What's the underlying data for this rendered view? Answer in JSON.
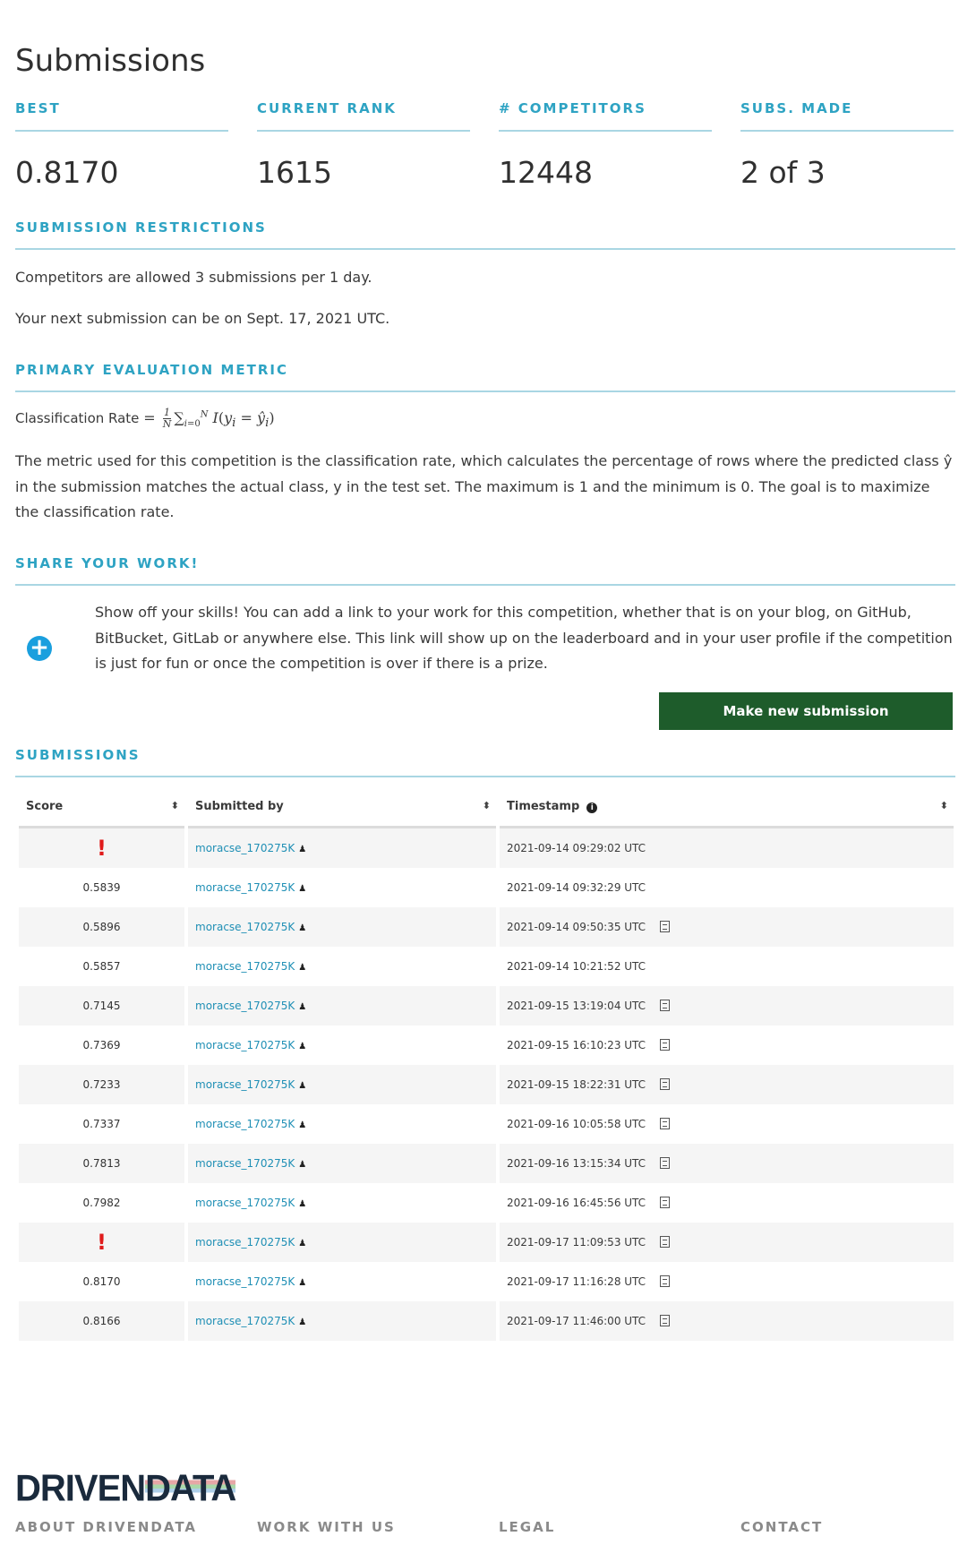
{
  "page": {
    "title": "Submissions"
  },
  "stats": [
    {
      "label": "BEST",
      "value": "0.8170"
    },
    {
      "label": "CURRENT RANK",
      "value": "1615"
    },
    {
      "label": "# COMPETITORS",
      "value": "12448"
    },
    {
      "label": "SUBS. MADE",
      "value": "2 of 3"
    }
  ],
  "restrictions": {
    "heading": "SUBMISSION RESTRICTIONS",
    "line1": "Competitors are allowed 3 submissions per 1 day.",
    "line2": "Your next submission can be on Sept. 17, 2021 UTC."
  },
  "metric": {
    "heading": "PRIMARY EVALUATION METRIC",
    "formula_label": "Classification Rate",
    "description": "The metric used for this competition is the classification rate, which calculates the percentage of rows where the predicted class ŷ in the submission matches the actual class, y in the test set. The maximum is 1 and the minimum is 0. The goal is to maximize the classification rate."
  },
  "share": {
    "heading": "SHARE YOUR WORK!",
    "text": "Show off your skills! You can add a link to your work for this competition, whether that is on your blog, on GitHub, BitBucket, GitLab or anywhere else. This link will show up on the leaderboard and in your user profile if the competition is just for fun or once the competition is over if there is a prize.",
    "icon": "plus-circle-icon"
  },
  "make_submission_label": "Make new submission",
  "submissions": {
    "heading": "SUBMISSIONS",
    "columns": [
      "Score",
      "Submitted by",
      "Timestamp"
    ],
    "rows": [
      {
        "score": "!",
        "error": true,
        "user": "moracse_170275K",
        "timestamp": "2021-09-14 09:29:02 UTC",
        "has_file": false
      },
      {
        "score": "0.5839",
        "error": false,
        "user": "moracse_170275K",
        "timestamp": "2021-09-14 09:32:29 UTC",
        "has_file": false
      },
      {
        "score": "0.5896",
        "error": false,
        "user": "moracse_170275K",
        "timestamp": "2021-09-14 09:50:35 UTC",
        "has_file": true
      },
      {
        "score": "0.5857",
        "error": false,
        "user": "moracse_170275K",
        "timestamp": "2021-09-14 10:21:52 UTC",
        "has_file": false
      },
      {
        "score": "0.7145",
        "error": false,
        "user": "moracse_170275K",
        "timestamp": "2021-09-15 13:19:04 UTC",
        "has_file": true
      },
      {
        "score": "0.7369",
        "error": false,
        "user": "moracse_170275K",
        "timestamp": "2021-09-15 16:10:23 UTC",
        "has_file": true
      },
      {
        "score": "0.7233",
        "error": false,
        "user": "moracse_170275K",
        "timestamp": "2021-09-15 18:22:31 UTC",
        "has_file": true
      },
      {
        "score": "0.7337",
        "error": false,
        "user": "moracse_170275K",
        "timestamp": "2021-09-16 10:05:58 UTC",
        "has_file": true
      },
      {
        "score": "0.7813",
        "error": false,
        "user": "moracse_170275K",
        "timestamp": "2021-09-16 13:15:34 UTC",
        "has_file": true
      },
      {
        "score": "0.7982",
        "error": false,
        "user": "moracse_170275K",
        "timestamp": "2021-09-16 16:45:56 UTC",
        "has_file": true
      },
      {
        "score": "!",
        "error": true,
        "user": "moracse_170275K",
        "timestamp": "2021-09-17 11:09:53 UTC",
        "has_file": true
      },
      {
        "score": "0.8170",
        "error": false,
        "user": "moracse_170275K",
        "timestamp": "2021-09-17 11:16:28 UTC",
        "has_file": true
      },
      {
        "score": "0.8166",
        "error": false,
        "user": "moracse_170275K",
        "timestamp": "2021-09-17 11:46:00 UTC",
        "has_file": true
      }
    ]
  },
  "footer": {
    "logo_drive": "DRIVEN",
    "logo_data": "DATA",
    "links": [
      "ABOUT DRIVENDATA",
      "WORK WITH US",
      "LEGAL",
      "CONTACT"
    ]
  },
  "colors": {
    "accent": "#2ea3c3",
    "button": "#1e5c2b",
    "error": "#e01b1b",
    "link": "#1f8fb5"
  }
}
